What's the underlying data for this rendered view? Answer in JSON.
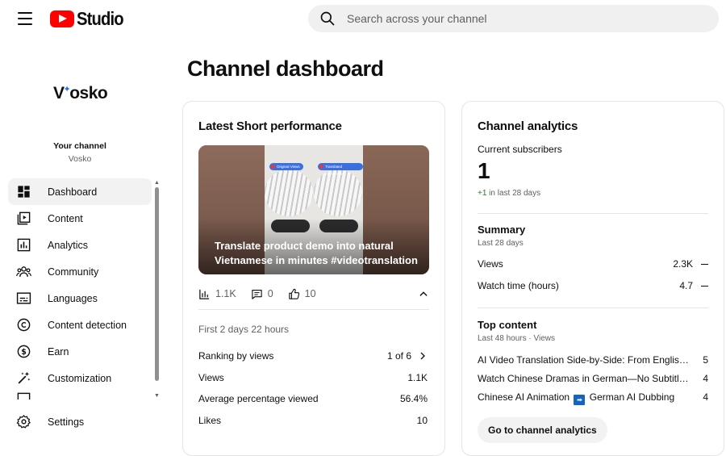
{
  "header": {
    "logo_text": "Studio",
    "search_placeholder": "Search across your channel"
  },
  "sidebar": {
    "channel_logo": {
      "prefix": "V",
      "rest": "osko"
    },
    "your_channel_label": "Your channel",
    "channel_name": "Vosko",
    "items": [
      {
        "label": "Dashboard",
        "icon": "dashboard-icon",
        "active": true
      },
      {
        "label": "Content",
        "icon": "content-icon"
      },
      {
        "label": "Analytics",
        "icon": "analytics-icon"
      },
      {
        "label": "Community",
        "icon": "community-icon"
      },
      {
        "label": "Languages",
        "icon": "languages-icon"
      },
      {
        "label": "Content detection",
        "icon": "copyright-icon"
      },
      {
        "label": "Earn",
        "icon": "dollar-icon"
      },
      {
        "label": "Customization",
        "icon": "magic-wand-icon"
      }
    ],
    "settings_label": "Settings"
  },
  "main": {
    "title": "Channel dashboard",
    "latest_short": {
      "title": "Latest Short performance",
      "video_title": "Translate product demo into natural Vietnamese in minutes #videotranslation",
      "thumb_pills": [
        "Original Views",
        "Translated Vietnamese"
      ],
      "views": "1.1K",
      "comments": "0",
      "likes": "10",
      "first_period": "First 2 days 22 hours",
      "metrics": [
        {
          "label": "Ranking by views",
          "value": "1 of 6"
        },
        {
          "label": "Views",
          "value": "1.1K"
        },
        {
          "label": "Average percentage viewed",
          "value": "56.4%"
        },
        {
          "label": "Likes",
          "value": "10"
        }
      ]
    },
    "analytics": {
      "title": "Channel analytics",
      "subscribers_label": "Current subscribers",
      "subscribers": "1",
      "subscribers_delta": "+1",
      "subscribers_delta_text": " in last 28 days",
      "summary_title": "Summary",
      "summary_period": "Last 28 days",
      "summary": [
        {
          "label": "Views",
          "value": "2.3K"
        },
        {
          "label": "Watch time (hours)",
          "value": "4.7"
        }
      ],
      "top_title": "Top content",
      "top_period": "Last 48 hours · Views",
      "top": [
        {
          "title": "AI Video Translation Side-by-Side: From English to Vietnamese",
          "value": "5"
        },
        {
          "title": "Watch Chinese Dramas in German—No Subtitles Needed",
          "value": "4"
        },
        {
          "title_a": "Chinese AI Animation",
          "title_b": "German AI Dubbing",
          "value": "4"
        }
      ],
      "button": "Go to channel analytics"
    }
  }
}
